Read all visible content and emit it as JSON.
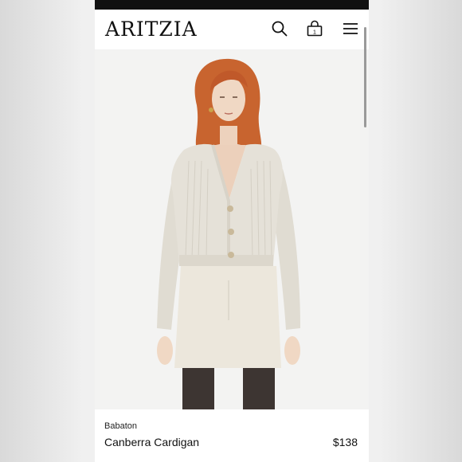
{
  "header": {
    "logo": "ARITZIA",
    "bag_count": "1",
    "icons": [
      "search-icon",
      "bag-icon",
      "menu-icon"
    ]
  },
  "product": {
    "brand": "Babaton",
    "name": "Canberra Cardigan",
    "price": "$138",
    "image": "product-photo"
  },
  "colors": {
    "status_bar": "#111111",
    "background": "#ffffff",
    "text": "#111111",
    "cardigan": "#e5e1d8",
    "skirt": "#ece7dc",
    "hair": "#c8642f"
  }
}
